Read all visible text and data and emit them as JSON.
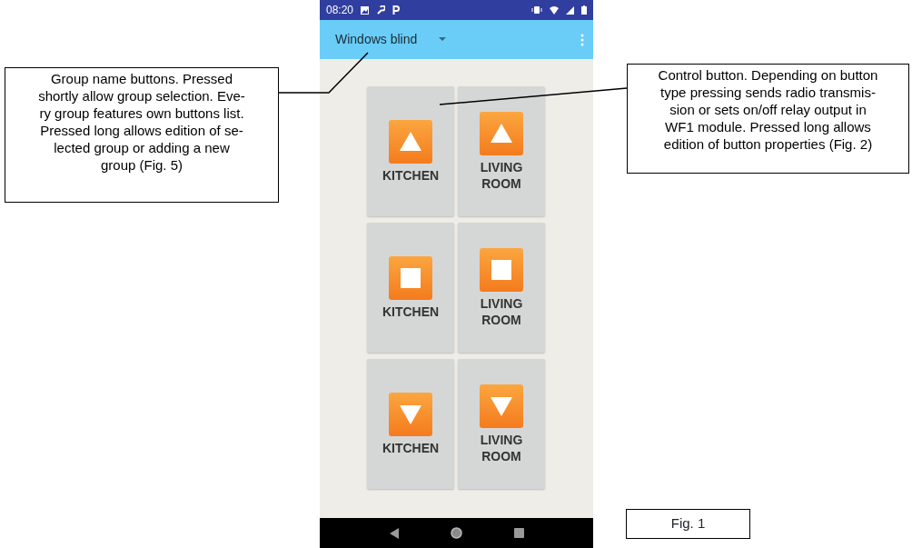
{
  "status_bar": {
    "time": "08:20"
  },
  "app_bar": {
    "group": "Windows blind"
  },
  "buttons": [
    {
      "kind": "up",
      "label": "KITCHEN"
    },
    {
      "kind": "up",
      "label": "LIVING ROOM"
    },
    {
      "kind": "stop",
      "label": "KITCHEN"
    },
    {
      "kind": "stop",
      "label": "LIVING ROOM"
    },
    {
      "kind": "down",
      "label": "KITCHEN"
    },
    {
      "kind": "down",
      "label": "LIVING ROOM"
    }
  ],
  "callouts": [
    {
      "kind": "left",
      "text": "Group name buttons. Pressed\nshortly allow group selection. Eve-\nry group features own buttons list.\nPressed long allows edition of se-\nlected group or adding a new\ngroup (Fig. 5)"
    },
    {
      "kind": "right",
      "text": "Control button. Depending on button\ntype pressing sends radio transmis-\nsion or sets on/off relay output in\nWF1 module. Pressed long allows\nedition of button properties (Fig. 2)"
    }
  ],
  "figure_label": "Fig. 1"
}
